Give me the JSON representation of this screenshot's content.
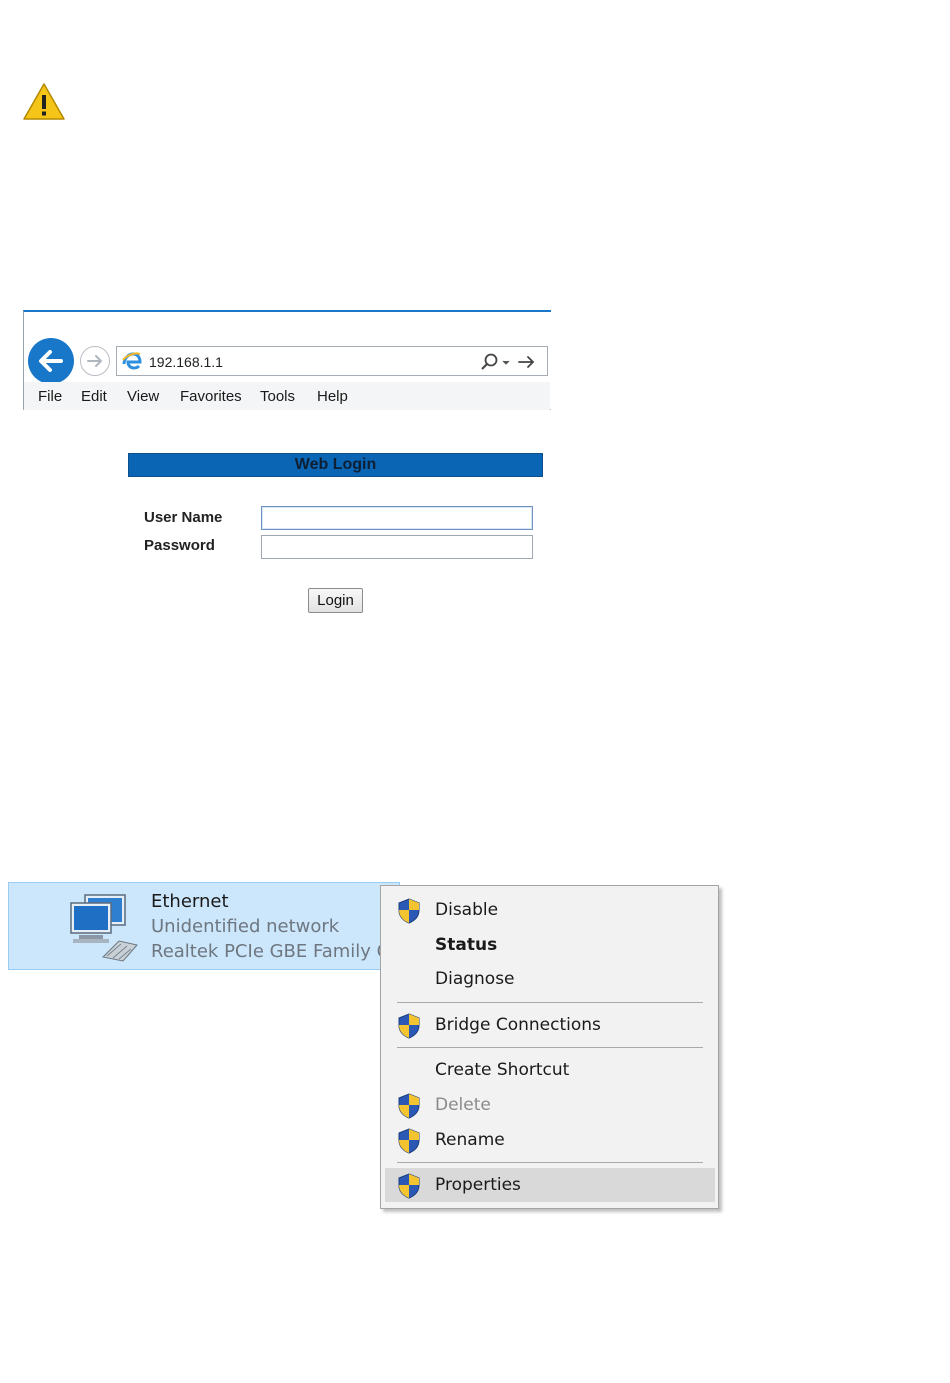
{
  "browser": {
    "address": "192.168.1.1",
    "menu": [
      "File",
      "Edit",
      "View",
      "Favorites",
      "Tools",
      "Help"
    ]
  },
  "login": {
    "title": "Web Login",
    "username_label": "User Name",
    "password_label": "Password",
    "username_value": "",
    "password_value": "",
    "button_label": "Login"
  },
  "ethernet": {
    "name": "Ethernet",
    "status": "Unidentified network",
    "adapter": "Realtek PCIe GBE Family C..."
  },
  "context_menu": {
    "items": [
      {
        "label": "Disable",
        "shield": true
      },
      {
        "label": "Status",
        "shield": false,
        "bold": true
      },
      {
        "label": "Diagnose",
        "shield": false
      },
      {
        "label": "Bridge Connections",
        "shield": true
      },
      {
        "label": "Create Shortcut",
        "shield": false
      },
      {
        "label": "Delete",
        "shield": true,
        "disabled": true
      },
      {
        "label": "Rename",
        "shield": true
      },
      {
        "label": "Properties",
        "shield": true,
        "highlighted": true
      }
    ]
  },
  "colors": {
    "accent": "#1877c8",
    "login_header": "#0a66b5",
    "tile_selected": "#cce6fb",
    "menu_highlight": "#d9d9d9"
  }
}
